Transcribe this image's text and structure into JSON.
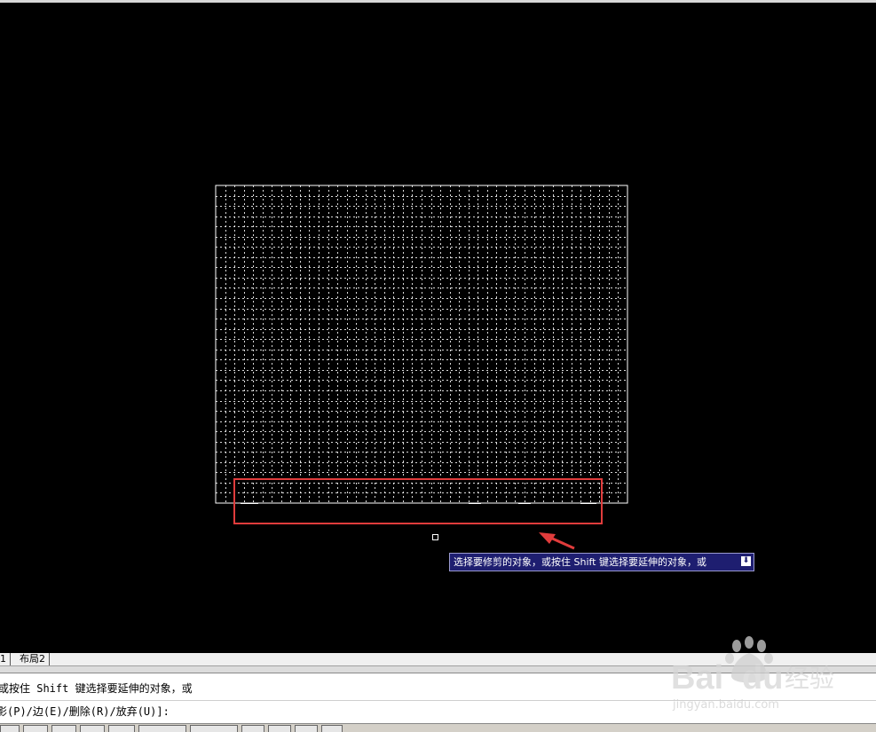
{
  "tabs": [
    "1",
    "布局2"
  ],
  "tooltip": {
    "text": "选择要修剪的对象，或按住 Shift 键选择要延伸的对象，或",
    "icon": "arrow-down-icon"
  },
  "command": {
    "line1": "或按住 Shift 键选择要延伸的对象，或",
    "line2": "影(P)/边(E)/删除(R)/放弃(U)]:"
  },
  "colors": {
    "canvas": "#000000",
    "grid_lines": "#ffffff",
    "highlight": "#e03c3c",
    "tooltip_bg": "#1e1e70"
  },
  "watermark": {
    "brand": "Baidu经验",
    "url": "jingyan.baidu.com"
  }
}
